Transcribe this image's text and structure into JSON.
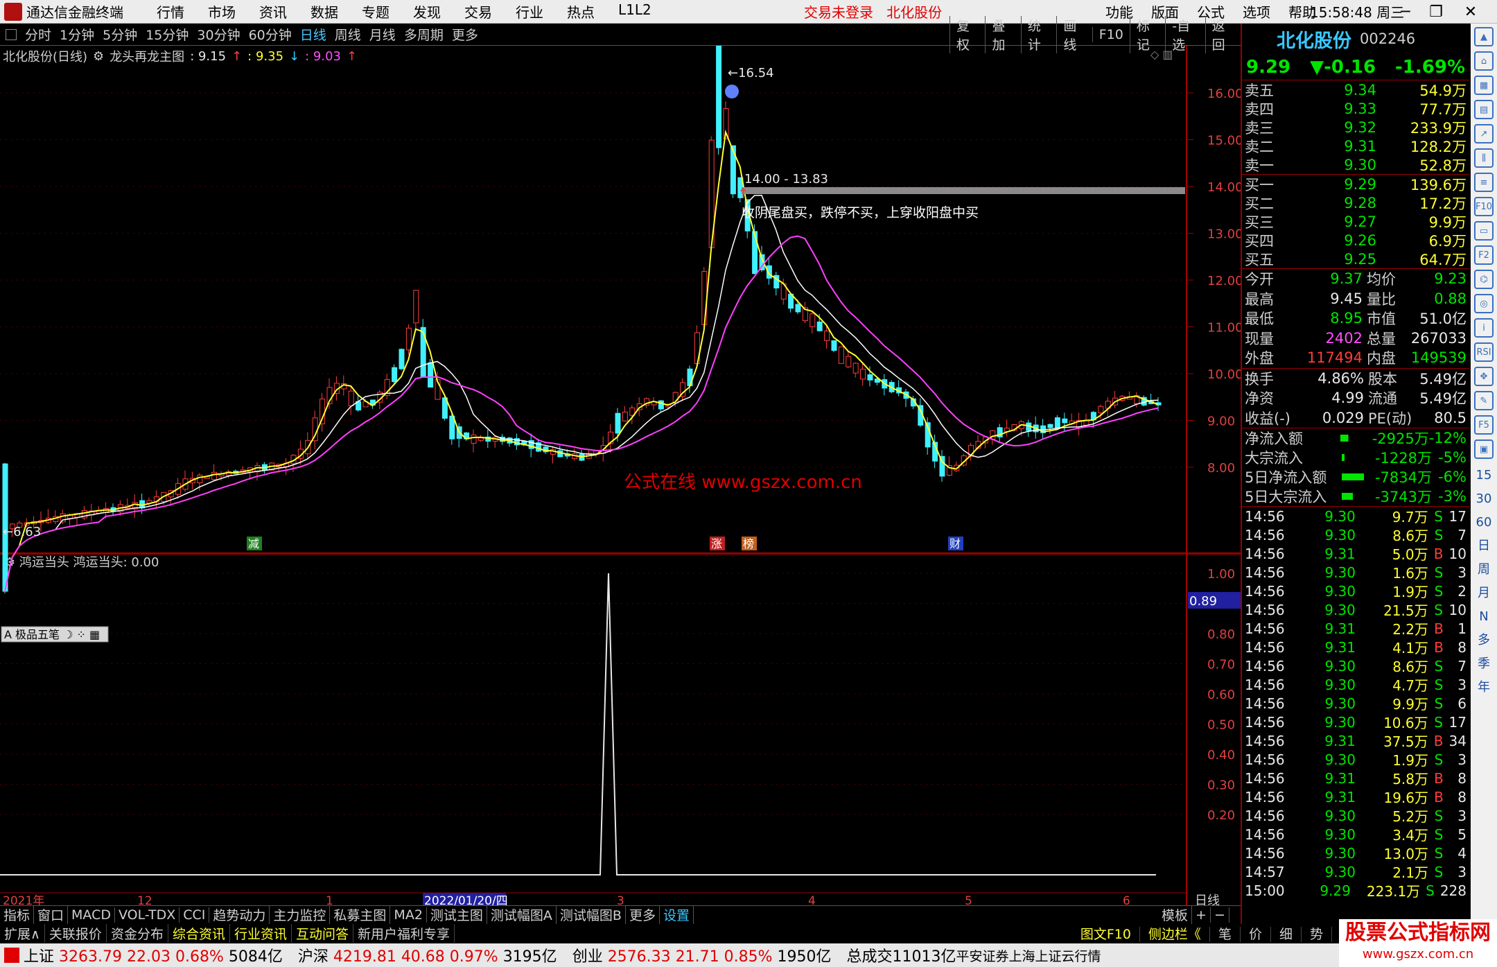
{
  "titlebar": {
    "app": "通达信金融终端",
    "menu": [
      "行情",
      "市场",
      "资讯",
      "数据",
      "专题",
      "发现",
      "交易",
      "行业",
      "热点",
      "L1L2"
    ],
    "login_status": "交易未登录",
    "stock": "北化股份",
    "right_menu": [
      "功能",
      "版面",
      "公式",
      "选项",
      "帮助"
    ],
    "time": "15:58:48",
    "weekday": "周三"
  },
  "periods": [
    "分时",
    "1分钟",
    "5分钟",
    "15分钟",
    "30分钟",
    "60分钟",
    "日线",
    "周线",
    "月线",
    "多周期",
    "更多"
  ],
  "active_period": "日线",
  "tools": [
    "复权",
    "叠加",
    "统计",
    "画线",
    "F10",
    "标记",
    "-自选",
    "返回"
  ],
  "chart_header": {
    "title": "北化股份(日线)",
    "formula": "龙头再龙主图",
    "v1": ": 9.15",
    "v2": ": 9.35",
    "v3": ": 9.03"
  },
  "main_chart": {
    "high_label": "16.54",
    "low_label": "6.63",
    "range_label": "14.00 - 13.83",
    "annotation": "收阴尾盘买，跌停不买，上穿收阳盘中买",
    "watermark": "公式在线  www.gszx.com.cn",
    "y_ticks": [
      "16.00",
      "15.00",
      "14.00",
      "13.00",
      "12.00",
      "11.00",
      "10.00",
      "9.00",
      "8.00"
    ],
    "markers": [
      "减",
      "涨",
      "榜",
      "财"
    ],
    "colors": {
      "up": "#ff3c3c",
      "down": "#40f0ff",
      "ma1": "#ffff30",
      "ma2": "#ffffff",
      "ma3": "#ff40ff"
    }
  },
  "chart_data": {
    "type": "candlestick",
    "dates_axis": [
      "2021年",
      "12",
      "1",
      "2022/01/20/四",
      "3",
      "4",
      "5",
      "6"
    ],
    "ylim": [
      6.0,
      17.0
    ]
  },
  "sub_chart": {
    "title": "鸿运当头",
    "value": "鸿运当头: 0.00",
    "cur_value": "0.89",
    "y_ticks": [
      "1.00",
      "0.90",
      "0.80",
      "0.70",
      "0.60",
      "0.50",
      "0.40",
      "0.30",
      "0.20"
    ],
    "toolbox": "极品五笔"
  },
  "quote": {
    "name": "北化股份",
    "code": "002246",
    "price": "9.29",
    "change": "▼-0.16",
    "pct": "-1.69%",
    "asks": [
      {
        "label": "卖五",
        "price": "9.34",
        "vol": "54.9万"
      },
      {
        "label": "卖四",
        "price": "9.33",
        "vol": "77.7万"
      },
      {
        "label": "卖三",
        "price": "9.32",
        "vol": "233.9万"
      },
      {
        "label": "卖二",
        "price": "9.31",
        "vol": "128.2万"
      },
      {
        "label": "卖一",
        "price": "9.30",
        "vol": "52.8万"
      }
    ],
    "bids": [
      {
        "label": "买一",
        "price": "9.29",
        "vol": "139.6万"
      },
      {
        "label": "买二",
        "price": "9.28",
        "vol": "17.2万"
      },
      {
        "label": "买三",
        "price": "9.27",
        "vol": "9.9万"
      },
      {
        "label": "买四",
        "price": "9.26",
        "vol": "6.9万"
      },
      {
        "label": "买五",
        "price": "9.25",
        "vol": "64.7万"
      }
    ],
    "stats1": [
      {
        "k1": "今开",
        "v1": "9.37",
        "k2": "均价",
        "v2": "9.23"
      },
      {
        "k1": "最高",
        "v1": "9.45",
        "k2": "量比",
        "v2": "0.88"
      },
      {
        "k1": "最低",
        "v1": "8.95",
        "k2": "市值",
        "v2": "51.0亿"
      },
      {
        "k1": "现量",
        "v1": "2402",
        "k2": "总量",
        "v2": "267033"
      },
      {
        "k1": "外盘",
        "v1": "117494",
        "k2": "内盘",
        "v2": "149539"
      }
    ],
    "stats2": [
      {
        "k1": "换手",
        "v1": "4.86%",
        "k2": "股本",
        "v2": "5.49亿"
      },
      {
        "k1": "净资",
        "v1": "4.99",
        "k2": "流通",
        "v2": "5.49亿"
      },
      {
        "k1": "收益(-)",
        "v1": "0.029",
        "k2": "PE(动)",
        "v2": "80.5"
      }
    ],
    "flows": [
      {
        "k": "净流入额",
        "v": "-2925万",
        "p": "-12%",
        "bar": 0.3
      },
      {
        "k": "大宗流入",
        "v": "-1228万",
        "p": "-5%",
        "bar": 0.1
      },
      {
        "k": "5日净流入额",
        "v": "-7834万",
        "p": "-6%",
        "bar": 0.8
      },
      {
        "k": "5日大宗流入",
        "v": "-3743万",
        "p": "-3%",
        "bar": 0.4
      }
    ],
    "ticks": [
      {
        "t": "14:56",
        "p": "9.30",
        "v": "9.7万",
        "bs": "S",
        "n": "17"
      },
      {
        "t": "14:56",
        "p": "9.30",
        "v": "8.6万",
        "bs": "S",
        "n": "7"
      },
      {
        "t": "14:56",
        "p": "9.31",
        "v": "5.0万",
        "bs": "B",
        "n": "10"
      },
      {
        "t": "14:56",
        "p": "9.30",
        "v": "1.6万",
        "bs": "S",
        "n": "3"
      },
      {
        "t": "14:56",
        "p": "9.30",
        "v": "1.9万",
        "bs": "S",
        "n": "2"
      },
      {
        "t": "14:56",
        "p": "9.30",
        "v": "21.5万",
        "bs": "S",
        "n": "10"
      },
      {
        "t": "14:56",
        "p": "9.31",
        "v": "2.2万",
        "bs": "B",
        "n": "1"
      },
      {
        "t": "14:56",
        "p": "9.31",
        "v": "4.1万",
        "bs": "B",
        "n": "8"
      },
      {
        "t": "14:56",
        "p": "9.30",
        "v": "8.6万",
        "bs": "S",
        "n": "7"
      },
      {
        "t": "14:56",
        "p": "9.30",
        "v": "4.7万",
        "bs": "S",
        "n": "3"
      },
      {
        "t": "14:56",
        "p": "9.30",
        "v": "9.9万",
        "bs": "S",
        "n": "6"
      },
      {
        "t": "14:56",
        "p": "9.30",
        "v": "10.6万",
        "bs": "S",
        "n": "17"
      },
      {
        "t": "14:56",
        "p": "9.31",
        "v": "37.5万",
        "bs": "B",
        "n": "34"
      },
      {
        "t": "14:56",
        "p": "9.30",
        "v": "1.9万",
        "bs": "S",
        "n": "3"
      },
      {
        "t": "14:56",
        "p": "9.31",
        "v": "5.8万",
        "bs": "B",
        "n": "8"
      },
      {
        "t": "14:56",
        "p": "9.31",
        "v": "19.6万",
        "bs": "B",
        "n": "8"
      },
      {
        "t": "14:56",
        "p": "9.30",
        "v": "5.2万",
        "bs": "S",
        "n": "3"
      },
      {
        "t": "14:56",
        "p": "9.30",
        "v": "3.4万",
        "bs": "S",
        "n": "5"
      },
      {
        "t": "14:56",
        "p": "9.30",
        "v": "13.0万",
        "bs": "S",
        "n": "4"
      },
      {
        "t": "14:57",
        "p": "9.30",
        "v": "2.1万",
        "bs": "S",
        "n": "3"
      },
      {
        "t": "15:00",
        "p": "9.29",
        "v": "223.1万",
        "bs": "S",
        "n": "228"
      }
    ]
  },
  "side_icons": [
    "日",
    "周",
    "月",
    "N",
    "多",
    "季",
    "年"
  ],
  "bottom_tabs1": [
    "指标",
    "窗口",
    "MACD",
    "VOL-TDX",
    "CCI",
    "趋势动力",
    "主力监控",
    "私募主图",
    "MA2",
    "测试主图",
    "测试幅图A",
    "测试幅图B",
    "更多",
    "设置",
    "模板",
    "+",
    "−"
  ],
  "bottom_tabs2": [
    "扩展∧",
    "关联报价",
    "资金分布",
    "综合资讯",
    "行业资讯",
    "互动问答",
    "新用户福利专享"
  ],
  "bottom_right": [
    "图文F10",
    "侧边栏《",
    "笔",
    "价",
    "细",
    "势"
  ],
  "axis_label_right": "日线",
  "indices": [
    {
      "name": "上证",
      "val": "3263.79",
      "chg": "22.03",
      "pct": "0.68%",
      "amt": "5084亿"
    },
    {
      "name": "沪深",
      "val": "4219.81",
      "chg": "40.68",
      "pct": "0.97%",
      "amt": "3195亿"
    },
    {
      "name": "创业",
      "val": "2576.33",
      "chg": "21.71",
      "pct": "0.85%",
      "amt": "1950亿"
    }
  ],
  "total_label": "总成交",
  "total_val": "11013亿",
  "broker": "平安证券上海上证云行情",
  "brand": {
    "line1": "股票公式指标网",
    "line2": "www.gszx.com.cn"
  }
}
